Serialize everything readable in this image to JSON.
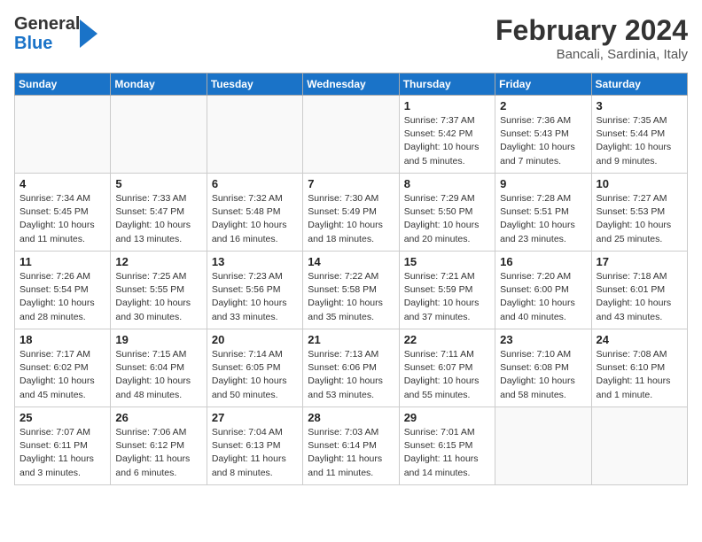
{
  "header": {
    "logo_general": "General",
    "logo_blue": "Blue",
    "month_year": "February 2024",
    "location": "Bancali, Sardinia, Italy"
  },
  "days_of_week": [
    "Sunday",
    "Monday",
    "Tuesday",
    "Wednesday",
    "Thursday",
    "Friday",
    "Saturday"
  ],
  "weeks": [
    [
      {
        "day": "",
        "info": ""
      },
      {
        "day": "",
        "info": ""
      },
      {
        "day": "",
        "info": ""
      },
      {
        "day": "",
        "info": ""
      },
      {
        "day": "1",
        "info": "Sunrise: 7:37 AM\nSunset: 5:42 PM\nDaylight: 10 hours\nand 5 minutes."
      },
      {
        "day": "2",
        "info": "Sunrise: 7:36 AM\nSunset: 5:43 PM\nDaylight: 10 hours\nand 7 minutes."
      },
      {
        "day": "3",
        "info": "Sunrise: 7:35 AM\nSunset: 5:44 PM\nDaylight: 10 hours\nand 9 minutes."
      }
    ],
    [
      {
        "day": "4",
        "info": "Sunrise: 7:34 AM\nSunset: 5:45 PM\nDaylight: 10 hours\nand 11 minutes."
      },
      {
        "day": "5",
        "info": "Sunrise: 7:33 AM\nSunset: 5:47 PM\nDaylight: 10 hours\nand 13 minutes."
      },
      {
        "day": "6",
        "info": "Sunrise: 7:32 AM\nSunset: 5:48 PM\nDaylight: 10 hours\nand 16 minutes."
      },
      {
        "day": "7",
        "info": "Sunrise: 7:30 AM\nSunset: 5:49 PM\nDaylight: 10 hours\nand 18 minutes."
      },
      {
        "day": "8",
        "info": "Sunrise: 7:29 AM\nSunset: 5:50 PM\nDaylight: 10 hours\nand 20 minutes."
      },
      {
        "day": "9",
        "info": "Sunrise: 7:28 AM\nSunset: 5:51 PM\nDaylight: 10 hours\nand 23 minutes."
      },
      {
        "day": "10",
        "info": "Sunrise: 7:27 AM\nSunset: 5:53 PM\nDaylight: 10 hours\nand 25 minutes."
      }
    ],
    [
      {
        "day": "11",
        "info": "Sunrise: 7:26 AM\nSunset: 5:54 PM\nDaylight: 10 hours\nand 28 minutes."
      },
      {
        "day": "12",
        "info": "Sunrise: 7:25 AM\nSunset: 5:55 PM\nDaylight: 10 hours\nand 30 minutes."
      },
      {
        "day": "13",
        "info": "Sunrise: 7:23 AM\nSunset: 5:56 PM\nDaylight: 10 hours\nand 33 minutes."
      },
      {
        "day": "14",
        "info": "Sunrise: 7:22 AM\nSunset: 5:58 PM\nDaylight: 10 hours\nand 35 minutes."
      },
      {
        "day": "15",
        "info": "Sunrise: 7:21 AM\nSunset: 5:59 PM\nDaylight: 10 hours\nand 37 minutes."
      },
      {
        "day": "16",
        "info": "Sunrise: 7:20 AM\nSunset: 6:00 PM\nDaylight: 10 hours\nand 40 minutes."
      },
      {
        "day": "17",
        "info": "Sunrise: 7:18 AM\nSunset: 6:01 PM\nDaylight: 10 hours\nand 43 minutes."
      }
    ],
    [
      {
        "day": "18",
        "info": "Sunrise: 7:17 AM\nSunset: 6:02 PM\nDaylight: 10 hours\nand 45 minutes."
      },
      {
        "day": "19",
        "info": "Sunrise: 7:15 AM\nSunset: 6:04 PM\nDaylight: 10 hours\nand 48 minutes."
      },
      {
        "day": "20",
        "info": "Sunrise: 7:14 AM\nSunset: 6:05 PM\nDaylight: 10 hours\nand 50 minutes."
      },
      {
        "day": "21",
        "info": "Sunrise: 7:13 AM\nSunset: 6:06 PM\nDaylight: 10 hours\nand 53 minutes."
      },
      {
        "day": "22",
        "info": "Sunrise: 7:11 AM\nSunset: 6:07 PM\nDaylight: 10 hours\nand 55 minutes."
      },
      {
        "day": "23",
        "info": "Sunrise: 7:10 AM\nSunset: 6:08 PM\nDaylight: 10 hours\nand 58 minutes."
      },
      {
        "day": "24",
        "info": "Sunrise: 7:08 AM\nSunset: 6:10 PM\nDaylight: 11 hours\nand 1 minute."
      }
    ],
    [
      {
        "day": "25",
        "info": "Sunrise: 7:07 AM\nSunset: 6:11 PM\nDaylight: 11 hours\nand 3 minutes."
      },
      {
        "day": "26",
        "info": "Sunrise: 7:06 AM\nSunset: 6:12 PM\nDaylight: 11 hours\nand 6 minutes."
      },
      {
        "day": "27",
        "info": "Sunrise: 7:04 AM\nSunset: 6:13 PM\nDaylight: 11 hours\nand 8 minutes."
      },
      {
        "day": "28",
        "info": "Sunrise: 7:03 AM\nSunset: 6:14 PM\nDaylight: 11 hours\nand 11 minutes."
      },
      {
        "day": "29",
        "info": "Sunrise: 7:01 AM\nSunset: 6:15 PM\nDaylight: 11 hours\nand 14 minutes."
      },
      {
        "day": "",
        "info": ""
      },
      {
        "day": "",
        "info": ""
      }
    ]
  ]
}
